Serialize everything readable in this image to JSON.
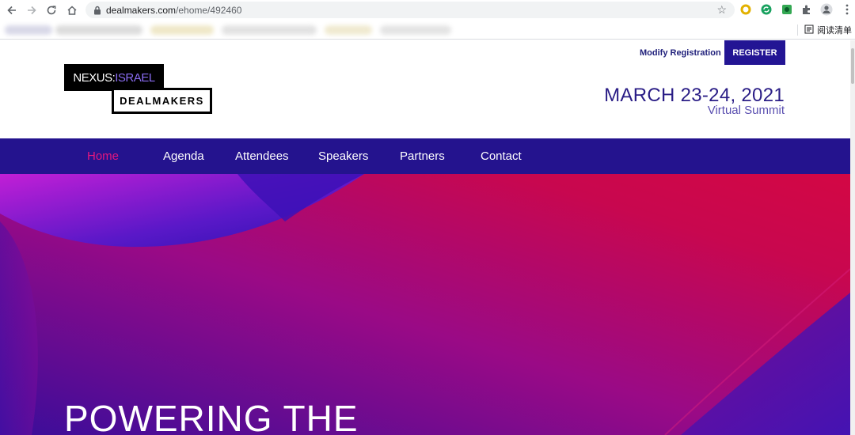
{
  "browser": {
    "url_domain": "dealmakers.com",
    "url_path": "/ehome/492460",
    "reading_list_label": "阅读清单"
  },
  "header": {
    "logo_nexus": "NEXUS:",
    "logo_israel": "ISRAEL",
    "logo_dealmakers": "DEALMAKERS",
    "modify_registration": "Modify Registration",
    "register": "REGISTER",
    "event_date": "MARCH 23-24, 2021",
    "event_subtitle": "Virtual Summit"
  },
  "nav": {
    "items": [
      {
        "label": "Home",
        "active": true
      },
      {
        "label": "Agenda"
      },
      {
        "label": "Attendees"
      },
      {
        "label": "Speakers"
      },
      {
        "label": "Partners"
      },
      {
        "label": "Contact"
      }
    ]
  },
  "hero": {
    "title": "POWERING THE"
  },
  "colors": {
    "brand_navy": "#24138e",
    "nav_active": "#e5177e",
    "date_text": "#2a1d86"
  }
}
